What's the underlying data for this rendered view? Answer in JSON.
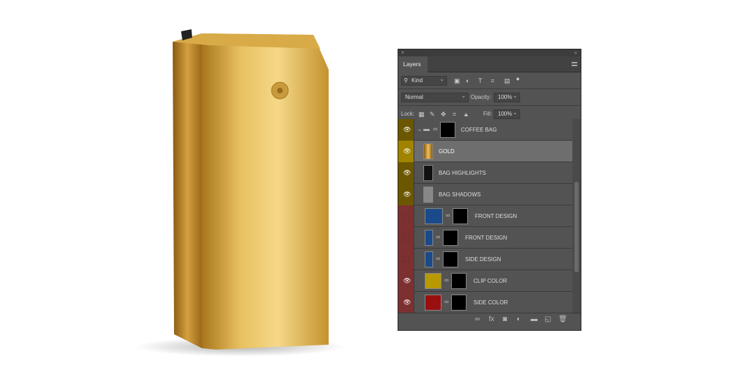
{
  "panel": {
    "title": "Layers",
    "filter": "Kind",
    "blend_mode": "Normal",
    "opacity_label": "Opacity:",
    "opacity": "100%",
    "lock_label": "Lock:",
    "fill_label": "Fill:",
    "fill": "100%"
  },
  "layers": [
    {
      "name": "COFFEE BAG",
      "visible": true,
      "type": "group",
      "tag": "#6b5700"
    },
    {
      "name": "GOLD",
      "visible": true,
      "selected": true,
      "tag": "#a08400"
    },
    {
      "name": "BAG HIGHLIGHTS",
      "visible": true,
      "tag": "#6b5700"
    },
    {
      "name": "BAG SHADOWS",
      "visible": true,
      "tag": "#6b5700"
    },
    {
      "name": "FRONT DESIGN",
      "visible": false,
      "tag": "#7d3030"
    },
    {
      "name": "FRONT DESIGN",
      "visible": false,
      "tag": "#7d3030"
    },
    {
      "name": "SIDE DESIGN",
      "visible": false,
      "tag": "#7d3030"
    },
    {
      "name": "CLIP COLOR",
      "visible": true,
      "tag": "#7d3030",
      "fill": "#b89a00"
    },
    {
      "name": "SIDE COLOR",
      "visible": true,
      "tag": "#7d3030",
      "fill": "#9a1010"
    }
  ],
  "footer_icons": [
    "link-icon",
    "fx-icon",
    "mask-icon",
    "adjustment-icon",
    "folder-icon",
    "new-layer-icon",
    "trash-icon"
  ]
}
